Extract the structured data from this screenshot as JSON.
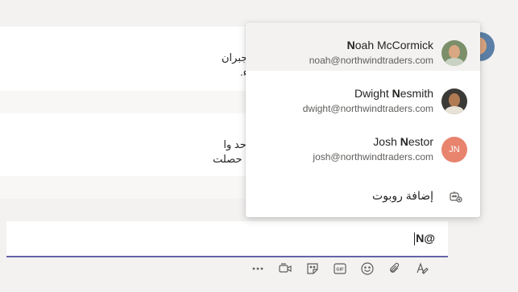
{
  "chat": {
    "message_1": [
      "العميل بإجراء بعض التغييرات على تصميمنا لجبران",
      "يرجى هذه التعديلات قبل تسليم عميل الأربعاء."
    ],
    "message_2": [
      "التجارية تحتوي على قسم منتجات \"اشتري واحد وا",
      "لقد بحثت عن شهر أغسطس لكنها ذكرت أنها حصلت"
    ]
  },
  "mention_popup": {
    "items": [
      {
        "name_bold": "N",
        "name_rest": "oah McCormick",
        "email": "noah@northwindtraders.com",
        "avatar": "photo",
        "selected": true
      },
      {
        "name_pre": "Dwight ",
        "name_bold": "N",
        "name_rest": "esmith",
        "email": "dwight@northwindtraders.com",
        "avatar": "photo",
        "selected": false
      },
      {
        "name_pre": "Josh ",
        "name_bold": "N",
        "name_rest": "estor",
        "email": "josh@northwindtraders.com",
        "avatar_initials": "JN",
        "selected": false
      }
    ],
    "add_bot_label": "إضافة روبوت"
  },
  "compose": {
    "text": "N@"
  },
  "toolbar": {
    "icons": [
      "more-icon",
      "meet-now-icon",
      "sticker-icon",
      "gif-icon",
      "emoji-icon",
      "attach-icon",
      "format-icon"
    ]
  },
  "colors": {
    "accent": "#6264a7",
    "josh_avatar": "#e8836e",
    "background": "#f3f2f1"
  }
}
